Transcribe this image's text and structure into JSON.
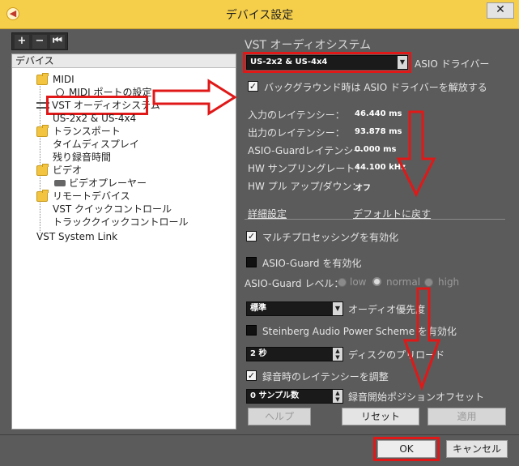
{
  "window": {
    "title": "デバイス設定",
    "close_glyph": "✕",
    "app_icon_glyph": "◀"
  },
  "tree": {
    "toolbar": {
      "add": "+",
      "remove": "−",
      "reset": "⏮"
    },
    "header": "デバイス",
    "items": {
      "midi": "MIDI",
      "midi_port": "MIDI ポートの設定",
      "vst_audio": "VST オーディオシステム",
      "us2x2": "US-2x2 & US-4x4",
      "transport": "トランスポート",
      "time_display": "タイムディスプレイ",
      "record_time": "残り録音時間",
      "video": "ビデオ",
      "video_player": "ビデオプレーヤー",
      "remote": "リモートデバイス",
      "vst_quick": "VST クイックコントロール",
      "track_quick": "トラッククイックコントロール",
      "vst_link": "VST System Link"
    }
  },
  "vst": {
    "title": "VST オーディオシステム",
    "driver_value": "US-2x2 & US-4x4",
    "driver_label": "ASIO ドライバー",
    "release_label": "バックグラウンド時は ASIO ドライバーを解放する",
    "release_checked": true,
    "latency": [
      {
        "label": "入力のレイテンシー：",
        "value": "46.440 ms"
      },
      {
        "label": "出力のレイテンシー：",
        "value": "93.878 ms"
      },
      {
        "label": "ASIO-Guardレイテンシー",
        "value": "0.000 ms"
      },
      {
        "label": "HW サンプリングレート：",
        "value": "44.100 kHz"
      },
      {
        "label": "HW プル アップ/ダウン：",
        "value": "オフ"
      }
    ],
    "advanced_label": "詳細設定",
    "default_link": "デフォルトに戻す",
    "multiprocessing_label": "マルチプロセッシングを有効化",
    "multiprocessing_checked": true,
    "asio_guard_label": "ASIO-Guard を有効化",
    "asio_guard_checked": false,
    "asio_guard_level_label": "ASIO-Guard レベル：",
    "levels": [
      "low",
      "normal",
      "high"
    ],
    "level_selected": "normal",
    "priority_value": "標準",
    "priority_label": "オーディオ優先度",
    "steinberg_label": "Steinberg Audio Power Scheme を有効化",
    "steinberg_checked": false,
    "disk_value": "2 秒",
    "disk_label": "ディスクのプリロード",
    "adjust_label": "録音時のレイテンシーを調整",
    "adjust_checked": true,
    "offset_value": "0 サンプル数",
    "offset_label": "録音開始ポジションオフセット",
    "help_button": "ヘルプ",
    "reset_button": "リセット",
    "apply_button": "適用"
  },
  "footer": {
    "ok_button": "OK",
    "cancel_button": "キャンセル"
  },
  "colors": {
    "title_bar": "#f6cf4a",
    "panel": "#5b5b5b",
    "highlight": "#e01818"
  }
}
